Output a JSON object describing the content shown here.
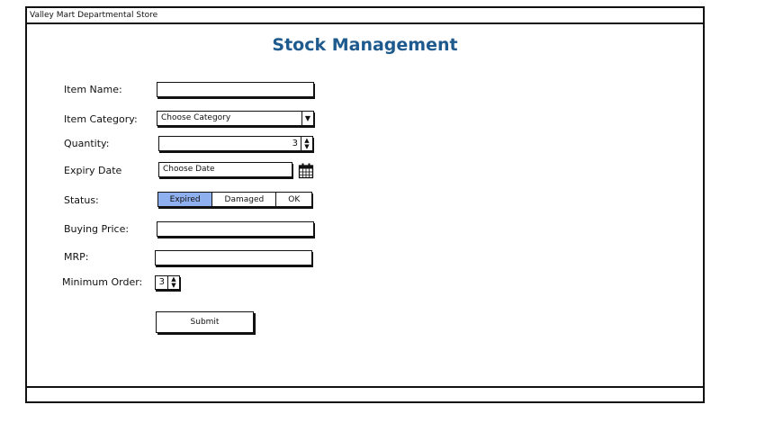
{
  "window": {
    "title": "Valley Mart Departmental Store"
  },
  "page": {
    "heading": "Stock Management"
  },
  "form": {
    "item_name": {
      "label": "Item Name:",
      "value": ""
    },
    "item_category": {
      "label": "Item Category:",
      "selected": "Choose Category"
    },
    "quantity": {
      "label": "Quantity:",
      "value": "3"
    },
    "expiry_date": {
      "label": "Expiry Date",
      "value": "Choose Date"
    },
    "status": {
      "label": "Status:",
      "options": [
        "Expired",
        "Damaged",
        "OK"
      ],
      "selected": "Expired"
    },
    "buying_price": {
      "label": "Buying Price:",
      "value": ""
    },
    "mrp": {
      "label": "MRP:",
      "value": ""
    },
    "minimum_order": {
      "label": "Minimum Order:",
      "value": "3"
    },
    "submit_label": "Submit"
  },
  "colors": {
    "heading": "#1e5a8e",
    "segment_active": "#8fb0ee"
  },
  "icons": {
    "calendar": "calendar-icon",
    "dropdown": "chevron-down-icon",
    "spinner": "up-down-arrows-icon"
  }
}
